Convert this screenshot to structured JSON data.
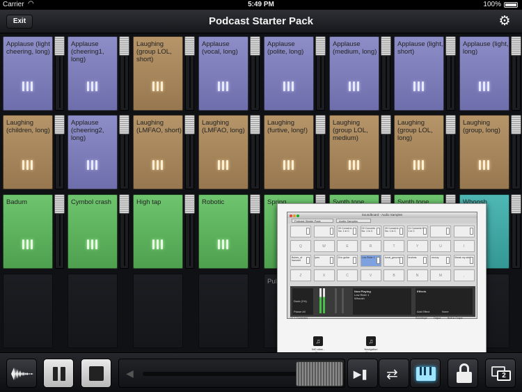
{
  "status_bar": {
    "carrier": "Carrier",
    "time": "5:49 PM",
    "battery": "100%"
  },
  "nav": {
    "exit_label": "Exit",
    "title": "Podcast Starter Pack",
    "settings_icon": "gear-icon"
  },
  "pads": [
    [
      {
        "label": "Applause (light cheering, long)",
        "color": "purple"
      },
      {
        "label": "Applause (cheering1, long)",
        "color": "purple"
      },
      {
        "label": "Laughing (group LOL, short)",
        "color": "tan"
      },
      {
        "label": "Applause (vocal, long)",
        "color": "purple"
      },
      {
        "label": "Applause (polite, long)",
        "color": "purple"
      },
      {
        "label": "Applause (medium, long)",
        "color": "purple"
      },
      {
        "label": "Applause (light, short)",
        "color": "purple"
      },
      {
        "label": "Applause (light, long)",
        "color": "purple"
      }
    ],
    [
      {
        "label": "Laughing (children, long)",
        "color": "tan"
      },
      {
        "label": "Applause (cheering2, long)",
        "color": "purple"
      },
      {
        "label": "Laughing (LMFAO, short)",
        "color": "tan"
      },
      {
        "label": "Laughing (LMFAO, long)",
        "color": "tan"
      },
      {
        "label": "Laughing (furtive, long!)",
        "color": "tan"
      },
      {
        "label": "Laughing (group LOL, medium)",
        "color": "tan"
      },
      {
        "label": "Laughing (group LOL, long)",
        "color": "tan"
      },
      {
        "label": "Laughing (group, long)",
        "color": "tan"
      }
    ],
    [
      {
        "label": "Badum",
        "color": "green"
      },
      {
        "label": "Cymbol crash",
        "color": "green"
      },
      {
        "label": "High tap",
        "color": "green"
      },
      {
        "label": "Robotic",
        "color": "green"
      },
      {
        "label": "Spring",
        "color": "green"
      },
      {
        "label": "Synth tone",
        "color": "green"
      },
      {
        "label": "Synth tone",
        "color": "green"
      },
      {
        "label": "Whoosh",
        "color": "teal"
      }
    ],
    [
      {
        "label": "",
        "color": "empty"
      },
      {
        "label": "",
        "color": "empty"
      },
      {
        "label": "",
        "color": "empty"
      },
      {
        "label": "",
        "color": "empty"
      },
      {
        "label": "Pul (rh lon",
        "color": "empty"
      },
      {
        "label": "",
        "color": "empty"
      },
      {
        "label": "",
        "color": "empty"
      },
      {
        "label": "",
        "color": "empty"
      }
    ]
  ],
  "overlay": {
    "window_title": "Soundboard - Audio Samples",
    "tabs": [
      "Podcast Starter Pack",
      "Audio Samples"
    ],
    "pad_labels": [
      "",
      "",
      "09 Concerto No. 1 in C",
      "09 Concerto No. 1 in C",
      "09 Concerto No. 1 in C",
      "11 Concerto No. 1 in C",
      "",
      "",
      "Q",
      "W",
      "E",
      "R",
      "T",
      "Y",
      "U",
      "I",
      "Bubes_of hazzard",
      "ipes",
      "Eric guitar",
      "Low Rider 1",
      "boral_groove",
      "brahms",
      "mccoy",
      "Break my stride",
      "Z",
      "X",
      "C",
      "V",
      "B",
      "N",
      "M",
      ","
    ],
    "volume_label": "Duck (1%)",
    "pause_all": "Pause All",
    "now_playing_header": "Now Playing",
    "now_playing": [
      "Low Rider 1",
      "Whoosh"
    ],
    "effects_header": "Effects",
    "effects_add": "Add Effect",
    "effects_value": "None",
    "connected_text": "+2: 1 Connected",
    "output_label": "Output",
    "output_value": "Built-in Output",
    "soundbar_text": "Soundrope",
    "desk_icons": [
      "040 alias - p45outo",
      "Navigation (Skypoole Deep)"
    ]
  },
  "toolbar": {
    "waveform_icon": "waveform-icon",
    "pause_icon": "pause-icon",
    "stop_icon": "stop-icon",
    "volume_icon": "speaker-icon",
    "volume_level": 0.92,
    "step_icon": "step-forward-icon",
    "loop_icon": "loop-icon",
    "keyboard_icon": "piano-icon",
    "lock_icon": "lock-icon",
    "screens_icon": "screens-icon",
    "screens_count": "2"
  },
  "colors": {
    "purple": "#7e7ebb",
    "tan": "#a88662",
    "green": "#5cb35c",
    "teal": "#43aaa7",
    "accent": "#3cc8ff"
  }
}
